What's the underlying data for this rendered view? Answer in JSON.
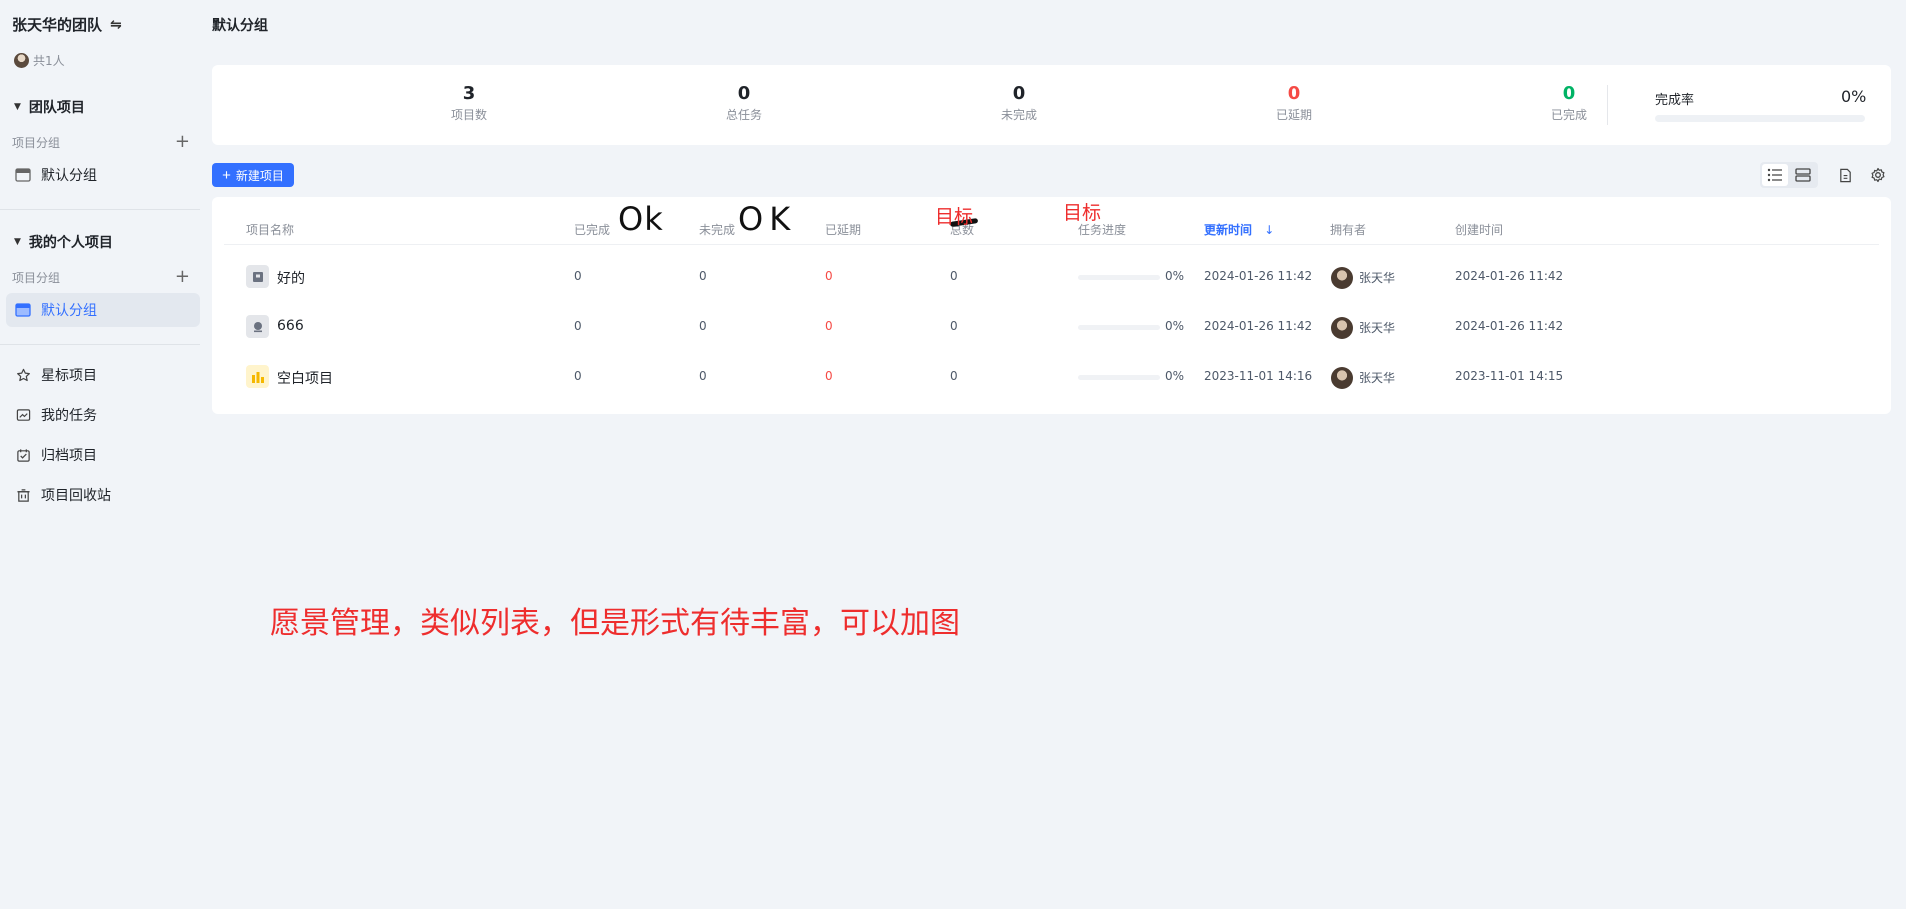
{
  "sidebar": {
    "team_title": "张天华的团队",
    "members": "共1人",
    "team_section": "团队项目",
    "team_group_label": "项目分组",
    "team_default_group": "默认分组",
    "personal_section": "我的个人项目",
    "personal_group_label": "项目分组",
    "personal_default_group": "默认分组",
    "links": [
      "星标项目",
      "我的任务",
      "归档项目",
      "项目回收站"
    ]
  },
  "page_title": "默认分组",
  "stats": {
    "projects": {
      "value": "3",
      "label": "项目数"
    },
    "total_tasks": {
      "value": "0",
      "label": "总任务"
    },
    "incomplete": {
      "value": "0",
      "label": "未完成"
    },
    "overdue": {
      "value": "0",
      "label": "已延期"
    },
    "done": {
      "value": "0",
      "label": "已完成"
    },
    "completion_label": "完成率",
    "completion_value": "0%",
    "completion_fraction": 0,
    "colors": {
      "overdue": "#f54a45",
      "done": "#00b365"
    }
  },
  "toolbar": {
    "new_project": "新建项目"
  },
  "table": {
    "columns": [
      "项目名称",
      "已完成",
      "未完成",
      "已延期",
      "总数",
      "任务进度",
      "更新时间",
      "拥有者",
      "创建时间"
    ],
    "rows": [
      {
        "name": "好的",
        "icon": "box-icon",
        "done": "0",
        "undone": "0",
        "overdue": "0",
        "total": "0",
        "progress": "0%",
        "updated": "2024-01-26 11:42",
        "owner": "张天华",
        "created": "2024-01-26 11:42"
      },
      {
        "name": "666",
        "icon": "image-icon",
        "done": "0",
        "undone": "0",
        "overdue": "0",
        "total": "0",
        "progress": "0%",
        "updated": "2024-01-26 11:42",
        "owner": "张天华",
        "created": "2024-01-26 11:42"
      },
      {
        "name": "空白项目",
        "icon": "bar-chart-icon",
        "done": "0",
        "undone": "0",
        "overdue": "0",
        "total": "0",
        "progress": "0%",
        "updated": "2023-11-01 14:16",
        "owner": "张天华",
        "created": "2023-11-01 14:15"
      }
    ]
  },
  "annotations": {
    "ok1": "Ok",
    "ok2": "OK",
    "target1": "目标",
    "target2": "目标",
    "note": "愿景管理，类似列表，但是形式有待丰富，可以加图"
  }
}
